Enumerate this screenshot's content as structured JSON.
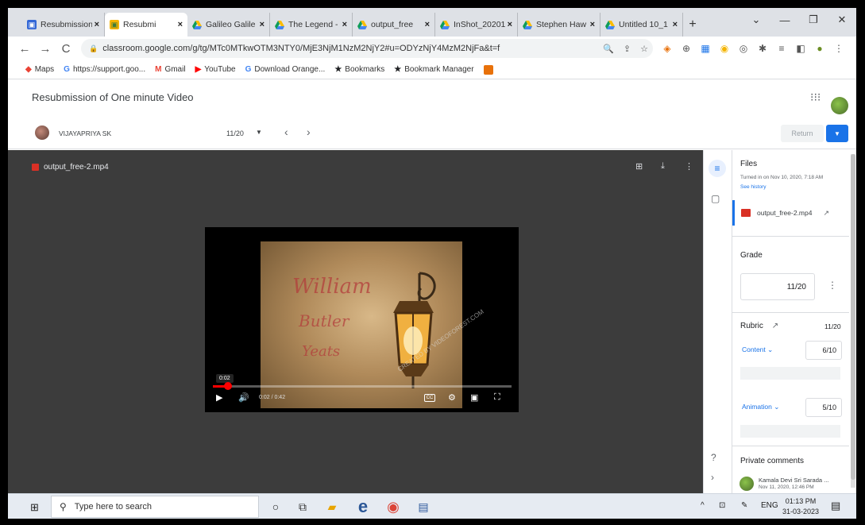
{
  "browser": {
    "tabs": [
      {
        "label": "Resubmission",
        "icon": "classroom-icon",
        "active": false
      },
      {
        "label": "Resubmi",
        "icon": "classroom-icon",
        "active": true
      },
      {
        "label": "Galileo Galile",
        "icon": "drive-icon",
        "active": false
      },
      {
        "label": "The Legend -",
        "icon": "drive-icon",
        "active": false
      },
      {
        "label": "output_free",
        "icon": "drive-icon",
        "active": false
      },
      {
        "label": "InShot_20201",
        "icon": "drive-icon",
        "active": false
      },
      {
        "label": "Stephen Haw",
        "icon": "drive-icon",
        "active": false
      },
      {
        "label": "Untitled 10_1",
        "icon": "drive-icon",
        "active": false
      }
    ],
    "close_glyph": "×",
    "new_tab_glyph": "+",
    "url": "classroom.google.com/g/tg/MTc0MTkwOTM3NTY0/MjE3NjM1NzM2NjY2#u=ODYzNjY4MzM2NjFa&t=f",
    "bookmarks": [
      {
        "label": "Maps",
        "icon": "maps-icon"
      },
      {
        "label": "https://support.goo...",
        "icon": "google-icon"
      },
      {
        "label": "Gmail",
        "icon": "gmail-icon"
      },
      {
        "label": "YouTube",
        "icon": "youtube-icon"
      },
      {
        "label": "Download Orange...",
        "icon": "google-icon"
      },
      {
        "label": "Bookmarks",
        "icon": "star-icon"
      },
      {
        "label": "Bookmark Manager",
        "icon": "star-icon"
      }
    ]
  },
  "classroom": {
    "title": "Resubmission of One minute Video",
    "student": {
      "name": "VIJAYAPRIYA SK",
      "count": "11/20"
    },
    "return_label": "Return"
  },
  "viewer": {
    "file_name": "output_free-2.mp4",
    "poster_words": [
      "William",
      "Butler",
      "Yeats"
    ],
    "watermark": "CREATED BY VIDEOFOREST.COM",
    "tooltip_time": "0:02",
    "time_display": "0:02 / 0:42",
    "progress": 0.05
  },
  "panel": {
    "files_heading": "Files",
    "turned_in": "Turned in on Nov 10, 2020, 7:18 AM",
    "see_history": "See history",
    "file_name": "output_free-2.mp4",
    "grade_heading": "Grade",
    "grade_value": "11/20",
    "rubric_heading": "Rubric",
    "rubric_score": "11/20",
    "criteria": [
      {
        "name": "Content",
        "score": "6/10"
      },
      {
        "name": "Animation",
        "score": "5/10"
      }
    ],
    "private_comments_heading": "Private comments",
    "comment_author": "Kamala Devi Sri Sarada ...",
    "comment_time": "Nov 11, 2020, 12:46 PM"
  },
  "taskbar": {
    "search_placeholder": "Type here to search",
    "language": "ENG",
    "time": "01:13 PM",
    "date": "31-03-2023"
  },
  "colors": {
    "accent": "#1a73e8",
    "viewer_bg": "#3c3c3c",
    "progress": "#ff0000"
  }
}
